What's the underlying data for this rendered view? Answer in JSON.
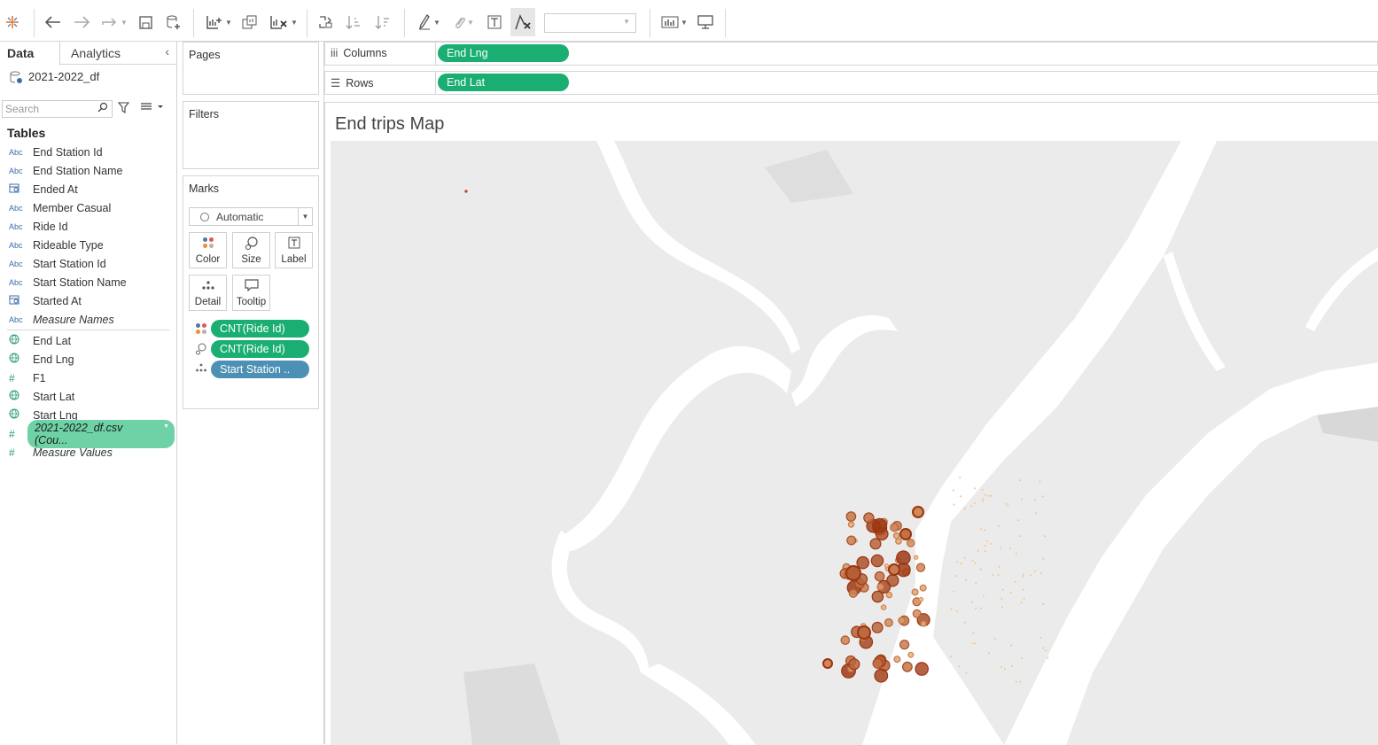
{
  "toolbar": {
    "icons": [
      "tableau-logo-icon",
      "undo-icon",
      "redo-icon",
      "replay-icon",
      "save-icon",
      "new-datasource-icon",
      "new-worksheet-icon",
      "duplicate-icon",
      "clear-sheet-icon",
      "swap-icon",
      "sort-ascending-icon",
      "sort-descending-icon",
      "highlight-icon",
      "group-icon",
      "label-icon",
      "fix-axes-icon",
      "fit-select",
      "show-me-icon",
      "presentation-icon"
    ],
    "fit_value": ""
  },
  "left_panel": {
    "tab_data": "Data",
    "tab_analytics": "Analytics",
    "datasource": "2021-2022_df",
    "search_placeholder": "Search",
    "tables_heading": "Tables",
    "dimensions": [
      {
        "type": "Abc",
        "name": "End Station Id"
      },
      {
        "type": "Abc",
        "name": "End Station Name"
      },
      {
        "type": "date",
        "name": "Ended At"
      },
      {
        "type": "Abc",
        "name": "Member Casual"
      },
      {
        "type": "Abc",
        "name": "Ride Id"
      },
      {
        "type": "Abc",
        "name": "Rideable Type"
      },
      {
        "type": "Abc",
        "name": "Start Station Id"
      },
      {
        "type": "Abc",
        "name": "Start Station Name"
      },
      {
        "type": "date",
        "name": "Started At"
      },
      {
        "type": "Abc",
        "name": "Measure Names"
      }
    ],
    "measures": [
      {
        "type": "geo",
        "name": "End Lat"
      },
      {
        "type": "geo",
        "name": "End Lng"
      },
      {
        "type": "#",
        "name": "F1"
      },
      {
        "type": "geo",
        "name": "Start Lat"
      },
      {
        "type": "geo",
        "name": "Start Lng"
      },
      {
        "type": "#",
        "name": "2021-2022_df.csv (Cou..."
      },
      {
        "type": "#",
        "name": "Measure Values"
      }
    ]
  },
  "cards": {
    "pages": "Pages",
    "filters": "Filters",
    "marks": "Marks",
    "mark_type": "Automatic",
    "buttons": {
      "color": "Color",
      "size": "Size",
      "label": "Label",
      "detail": "Detail",
      "tooltip": "Tooltip"
    },
    "pills": [
      {
        "icon": "color-encoding-icon",
        "label": "CNT(Ride Id)",
        "color": "#1aae72"
      },
      {
        "icon": "size-encoding-icon",
        "label": "CNT(Ride Id)",
        "color": "#1aae72"
      },
      {
        "icon": "detail-encoding-icon",
        "label": "Start Station ..",
        "color": "#4c90b5"
      }
    ]
  },
  "shelves": {
    "columns_label": "Columns",
    "columns_pill": "End Lng",
    "rows_label": "Rows",
    "rows_pill": "End Lat"
  },
  "view": {
    "title": "End trips Map"
  },
  "colors": {
    "accent_green": "#1aae72",
    "dimension_blue": "#4c90b5",
    "map_land": "#ebebeb",
    "map_water": "#ffffff",
    "mark_light": "#f5c48a",
    "mark_dark": "#9a3411"
  }
}
